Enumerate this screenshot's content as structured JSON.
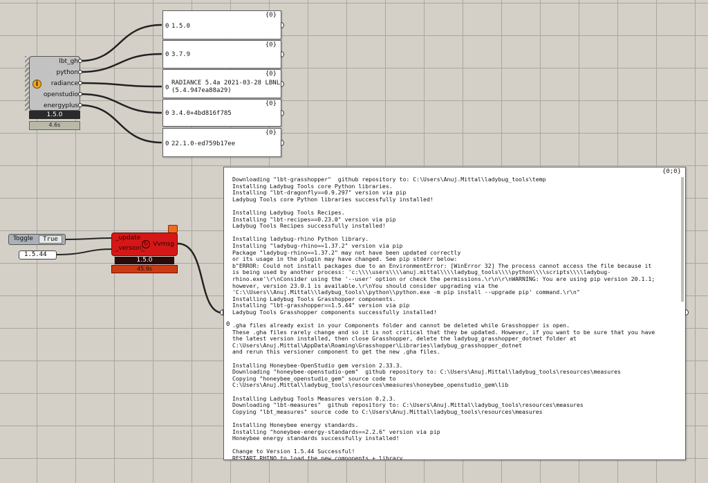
{
  "version_component": {
    "outputs": [
      "lbt_gh",
      "python",
      "radiance",
      "openstudio",
      "energyplus"
    ],
    "info_icon": "info-icon",
    "version": "1.5.0",
    "time": "4.6s"
  },
  "panels": [
    {
      "header": "{0}",
      "index": "0",
      "text": "1.5.0"
    },
    {
      "header": "{0}",
      "index": "0",
      "text": "3.7.9"
    },
    {
      "header": "{0}",
      "index": "0",
      "text": "RADIANCE 5.4a 2021-03-28 LBNL\n(5.4.947ea88a29)"
    },
    {
      "header": "{0}",
      "index": "0",
      "text": "3.4.0+4bd816f785"
    },
    {
      "header": "{0}",
      "index": "0",
      "text": "22.1.0-ed759b17ee"
    }
  ],
  "toggle": {
    "label": "Toggle",
    "value": "True"
  },
  "version_input": "1.5.44",
  "versioner": {
    "inputs": [
      "_update",
      "_version_"
    ],
    "output": "Vvmsg",
    "version": "1.5.0",
    "time": "45.9s",
    "warning_color": "#f06a1d",
    "body_color": "#d61717"
  },
  "log_panel": {
    "header": "{0;0}",
    "index": "0",
    "text": "Downloading \"lbt-grasshopper\"  github repository to: C:\\Users\\Anuj.Mittal\\ladybug_tools\\temp\nInstalling Ladybug Tools core Python libraries.\nInstalling \"lbt-dragonfly==0.9.297\" version via pip\nLadybug Tools core Python libraries successfully installed!\n\nInstalling Ladybug Tools Recipes.\nInstalling \"lbt-recipes==0.23.0\" version via pip\nLadybug Tools Recipes successfully installed!\n\nInstalling ladybug-rhino Python library.\nInstalling \"ladybug-rhino==1.37.2\" version via pip\nPackage \"ladybug-rhino==1.37.2\" may not have been updated correctly\nor its usage in the plugin may have changed. See pip stderr below:\nb\"ERROR: Could not install packages due to an EnvironmentError: [WinError 32] The process cannot access the file because it\nis being used by another process: 'c:\\\\\\\\users\\\\\\\\anuj.mittal\\\\\\\\ladybug_tools\\\\\\\\python\\\\\\\\scripts\\\\\\\\ladybug-\nrhino.exe'\\r\\nConsider using the '--user' option or check the permissions.\\r\\n\\r\\nWARNING: You are using pip version 20.1.1;\nhowever, version 23.0.1 is available.\\r\\nYou should consider upgrading via the\n'C:\\\\Users\\\\Anuj.Mittal\\\\ladybug_tools\\\\python\\\\python.exe -m pip install --upgrade pip' command.\\r\\n\"\nInstalling Ladybug Tools Grasshopper components.\nInstalling \"lbt-grasshopper==1.5.44\" version via pip\nLadybug Tools Grasshopper components successfully installed!\n\n.gha files already exist in your Components folder and cannot be deleted while Grasshopper is open.\nThese .gha files rarely change and so it is not critical that they be updated. However, if you want to be sure that you have\nthe latest version installed, then close Grasshopper, delete the ladybug_grasshopper_dotnet folder at\nC:\\Users\\Anuj.Mittal\\AppData\\Roaming\\Grasshopper\\Libraries\\ladybug_grasshopper_dotnet\nand rerun this versioner component to get the new .gha files.\n\nInstalling Honeybee-OpenStudio gem version 2.33.3.\nDownloading \"honeybee-openstudio-gem\"  github repository to: C:\\Users\\Anuj.Mittal\\ladybug_tools\\resources\\measures\nCopying \"honeybee_openstudio_gem\" source code to\nC:\\Users\\Anuj.Mittal\\ladybug_tools\\resources\\measures\\honeybee_openstudio_gem\\lib\n\nInstalling Ladybug Tools Measures version 0.2.3.\nDownloading \"lbt-measures\"  github repository to: C:\\Users\\Anuj.Mittal\\ladybug_tools\\resources\\measures\nCopying \"lbt_measures\" source code to C:\\Users\\Anuj.Mittal\\ladybug_tools\\resources\\measures\n\nInstalling Honeybee energy standards.\nInstalling \"honeybee-energy-standards==2.2.6\" version via pip\nHoneybee energy standards successfully installed!\n\nChange to Version 1.5.44 Successful!\nRESTART RHINO to load the new components + library."
  }
}
